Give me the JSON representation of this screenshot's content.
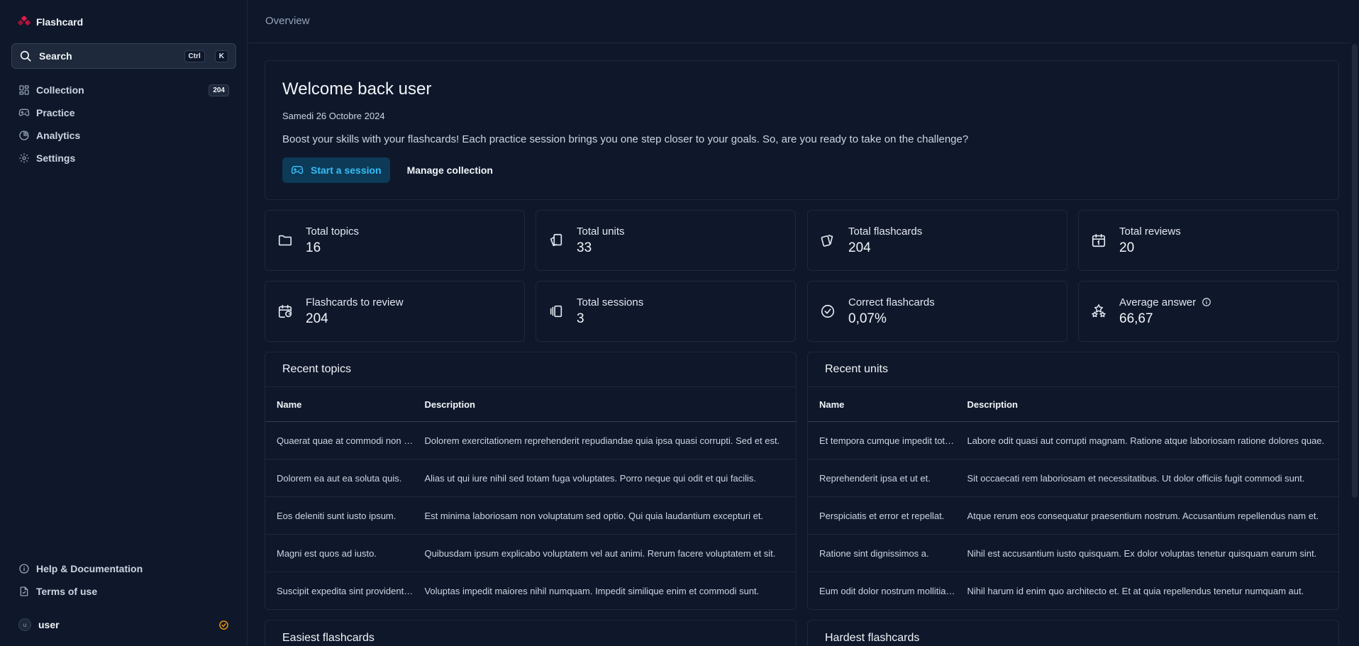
{
  "sidebar": {
    "brand": "Flashcard",
    "search": {
      "label": "Search",
      "kbd1": "Ctrl",
      "kbd2": "K"
    },
    "nav": [
      {
        "label": "Collection",
        "icon": "grid-icon",
        "count": "204"
      },
      {
        "label": "Practice",
        "icon": "gamepad-icon"
      },
      {
        "label": "Analytics",
        "icon": "pie-chart-icon"
      },
      {
        "label": "Settings",
        "icon": "gear-icon"
      }
    ],
    "bottom": [
      {
        "label": "Help & Documentation",
        "icon": "info-icon"
      },
      {
        "label": "Terms of use",
        "icon": "file-icon"
      }
    ],
    "user": {
      "initial": "u",
      "name": "user"
    }
  },
  "header": {
    "title": "Overview"
  },
  "welcome": {
    "title": "Welcome back user",
    "date": "Samedi 26 Octobre 2024",
    "message": "Boost your skills with your flashcards! Each practice session brings you one step closer to your goals. So, are you ready to take on the challenge?",
    "primary_button": "Start a session",
    "secondary_button": "Manage collection"
  },
  "stats": [
    {
      "label": "Total topics",
      "value": "16",
      "icon": "folder-icon"
    },
    {
      "label": "Total units",
      "value": "33",
      "icon": "cards-stack-icon"
    },
    {
      "label": "Total flashcards",
      "value": "204",
      "icon": "playing-cards-icon"
    },
    {
      "label": "Total reviews",
      "value": "20",
      "icon": "calendar-icon"
    },
    {
      "label": "Flashcards to review",
      "value": "204",
      "icon": "calendar-refresh-icon"
    },
    {
      "label": "Total sessions",
      "value": "3",
      "icon": "gallery-icon"
    },
    {
      "label": "Correct flashcards",
      "value": "0,07%",
      "icon": "check-circle-icon"
    },
    {
      "label": "Average answer",
      "value": "66,67",
      "icon": "stars-icon"
    }
  ],
  "recent_topics": {
    "title": "Recent topics",
    "columns": [
      "Name",
      "Description"
    ],
    "rows": [
      {
        "name": "Quaerat quae at commodi non ut.",
        "description": "Dolorem exercitationem reprehenderit repudiandae quia ipsa quasi corrupti. Sed et est."
      },
      {
        "name": "Dolorem ea aut ea soluta quis.",
        "description": "Alias ut qui iure nihil sed totam fuga voluptates. Porro neque qui odit et qui facilis."
      },
      {
        "name": "Eos deleniti sunt iusto ipsum.",
        "description": "Est minima laboriosam non voluptatum sed optio. Qui quia laudantium excepturi et."
      },
      {
        "name": "Magni est quos ad iusto.",
        "description": "Quibusdam ipsum explicabo voluptatem vel aut animi. Rerum facere voluptatem et sit."
      },
      {
        "name": "Suscipit expedita sint provident et.",
        "description": "Voluptas impedit maiores nihil numquam. Impedit similique enim et commodi sunt."
      }
    ]
  },
  "recent_units": {
    "title": "Recent units",
    "columns": [
      "Name",
      "Description"
    ],
    "rows": [
      {
        "name": "Et tempora cumque impedit totam.",
        "description": "Labore odit quasi aut corrupti magnam. Ratione atque laboriosam ratione dolores quae."
      },
      {
        "name": "Reprehenderit ipsa et ut et.",
        "description": "Sit occaecati rem laboriosam et necessitatibus. Ut dolor officiis fugit commodi sunt."
      },
      {
        "name": "Perspiciatis et error et repellat.",
        "description": "Atque rerum eos consequatur praesentium nostrum. Accusantium repellendus nam et."
      },
      {
        "name": "Ratione sint dignissimos a.",
        "description": "Nihil est accusantium iusto quisquam. Ex dolor voluptas tenetur quisquam earum sint."
      },
      {
        "name": "Eum odit dolor nostrum mollitia ut.",
        "description": "Nihil harum id enim quo architecto et. Et at quia repellendus tenetur numquam aut."
      }
    ]
  },
  "bottom_cards": [
    "Easiest flashcards",
    "Hardest flashcards"
  ],
  "colors": {
    "background": "#0f172a",
    "border": "#1e293b",
    "accent": "#38bdf8",
    "brand": "#e11d48",
    "verified": "#f59e0b"
  }
}
